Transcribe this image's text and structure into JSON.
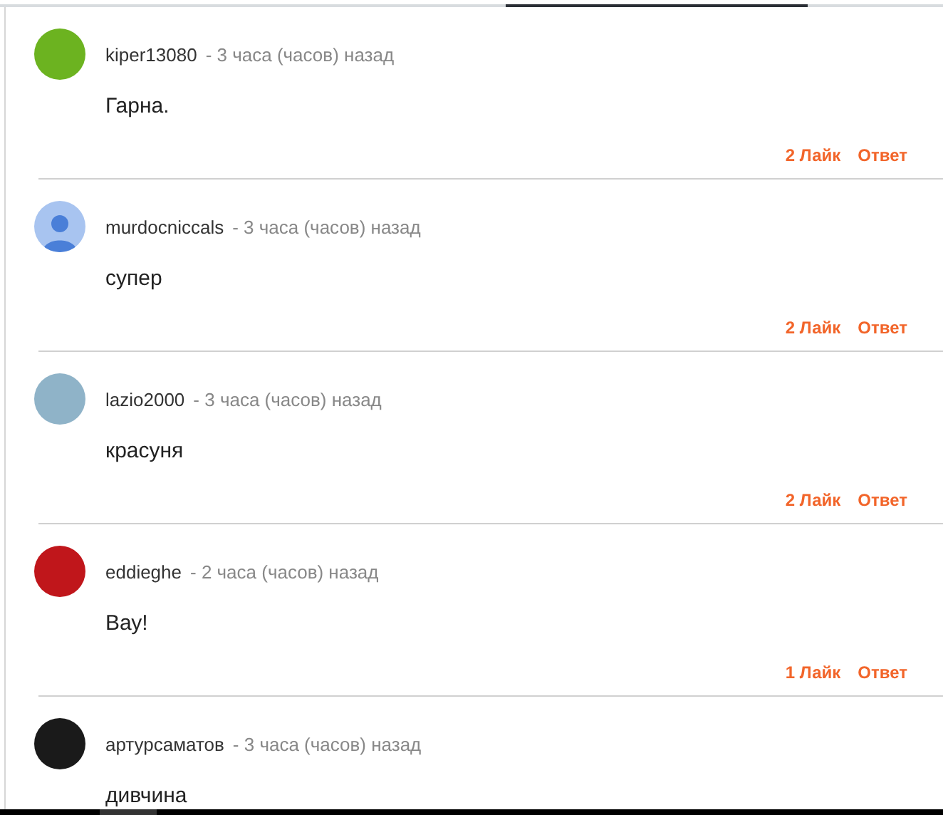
{
  "comments": [
    {
      "author": "kiper13080",
      "time": "- 3 часа (часов) назад",
      "text": "Гарна.",
      "likes": "2 Лайк",
      "reply": "Ответ",
      "avatar": {
        "kind": "photo",
        "color": "#6cb320"
      }
    },
    {
      "author": "murdocniccals",
      "time": "- 3 часа (часов) назад",
      "text": "супер",
      "likes": "2 Лайк",
      "reply": "Ответ",
      "avatar": {
        "kind": "default",
        "color": "#a8c4f0"
      }
    },
    {
      "author": "lazio2000",
      "time": "- 3 часа (часов) назад",
      "text": "красуня",
      "likes": "2 Лайк",
      "reply": "Ответ",
      "avatar": {
        "kind": "photo",
        "color": "#8fb3c8"
      }
    },
    {
      "author": "eddieghe",
      "time": "- 2 часа (часов) назад",
      "text": "Вау!",
      "likes": "1 Лайк",
      "reply": "Ответ",
      "avatar": {
        "kind": "photo",
        "color": "#c0161b"
      }
    },
    {
      "author": "артурсаматов",
      "time": "- 3 часа (часов) назад",
      "text": "дивчина",
      "avatar": {
        "kind": "photo",
        "color": "#1a1a1a"
      }
    }
  ]
}
